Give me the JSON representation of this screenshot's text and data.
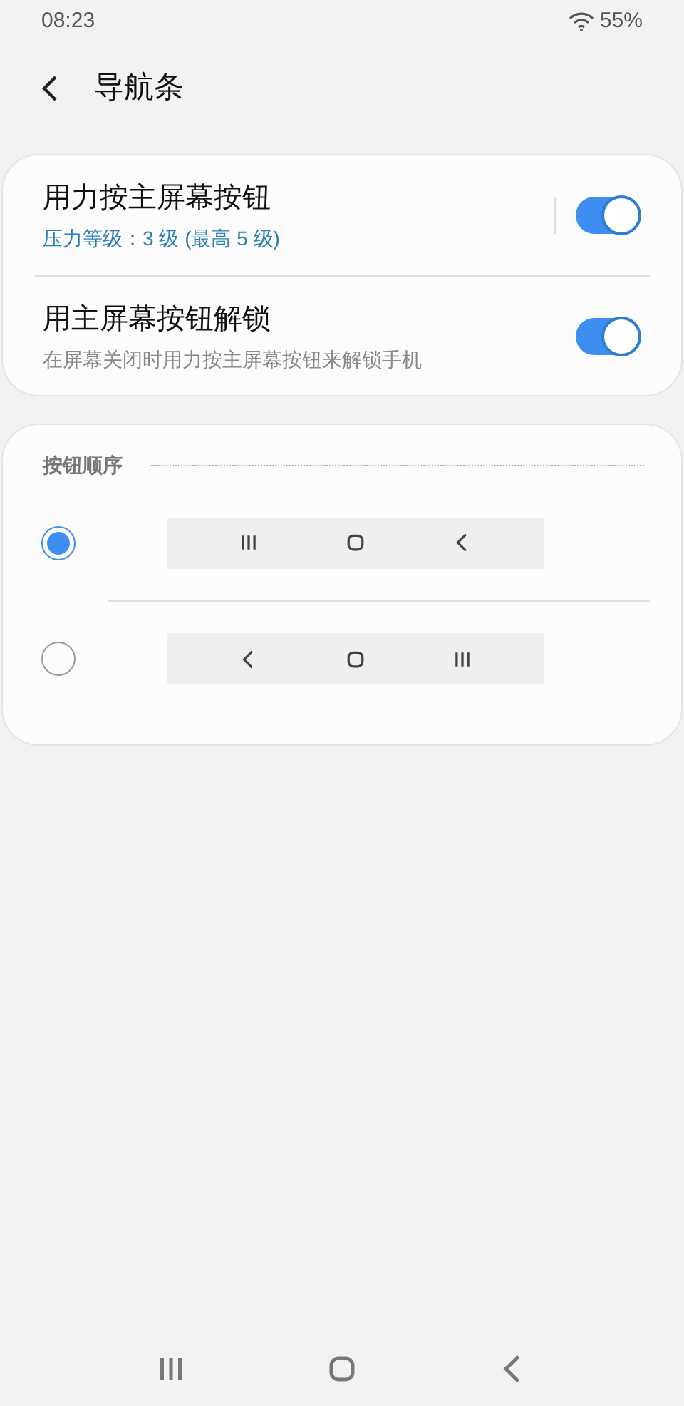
{
  "status_bar": {
    "time": "08:23",
    "battery": "55%"
  },
  "header": {
    "title": "导航条"
  },
  "switches": [
    {
      "title": "用力按主屏幕按钮",
      "subtitle": "压力等级：3 级 (最高 5 级)",
      "kind": "accent",
      "on": true,
      "divider": true
    },
    {
      "title": "用主屏幕按钮解锁",
      "subtitle": "在屏幕关闭时用力按主屏幕按钮来解锁手机",
      "kind": "plain",
      "on": true,
      "divider": false
    }
  ],
  "button_order": {
    "heading": "按钮顺序",
    "options": [
      {
        "selected": true,
        "buttons": [
          {
            "kind": "recents"
          },
          {
            "kind": "home"
          },
          {
            "kind": "back"
          }
        ]
      },
      {
        "selected": false,
        "buttons": [
          {
            "kind": "back"
          },
          {
            "kind": "home"
          },
          {
            "kind": "recents"
          }
        ]
      }
    ]
  },
  "navigation_bar": {
    "buttons": [
      {
        "kind": "recents"
      },
      {
        "kind": "home"
      },
      {
        "kind": "back"
      }
    ]
  }
}
